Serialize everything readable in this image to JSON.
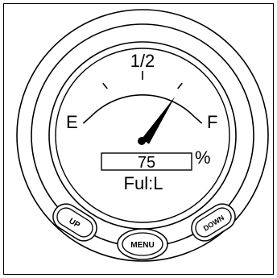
{
  "gauge": {
    "scale_empty": "E",
    "scale_half": "1/2",
    "scale_full": "F",
    "readout_value": "75",
    "readout_unit": "%",
    "mode_label": "Ful:L",
    "needle_level_percent": 75
  },
  "buttons": {
    "up_label": "UP",
    "menu_label": "MENU",
    "down_label": "DOWN"
  },
  "icons": {
    "needle": "gauge-needle-icon"
  },
  "colors": {
    "ink": "#000000",
    "face": "#ffffff"
  }
}
